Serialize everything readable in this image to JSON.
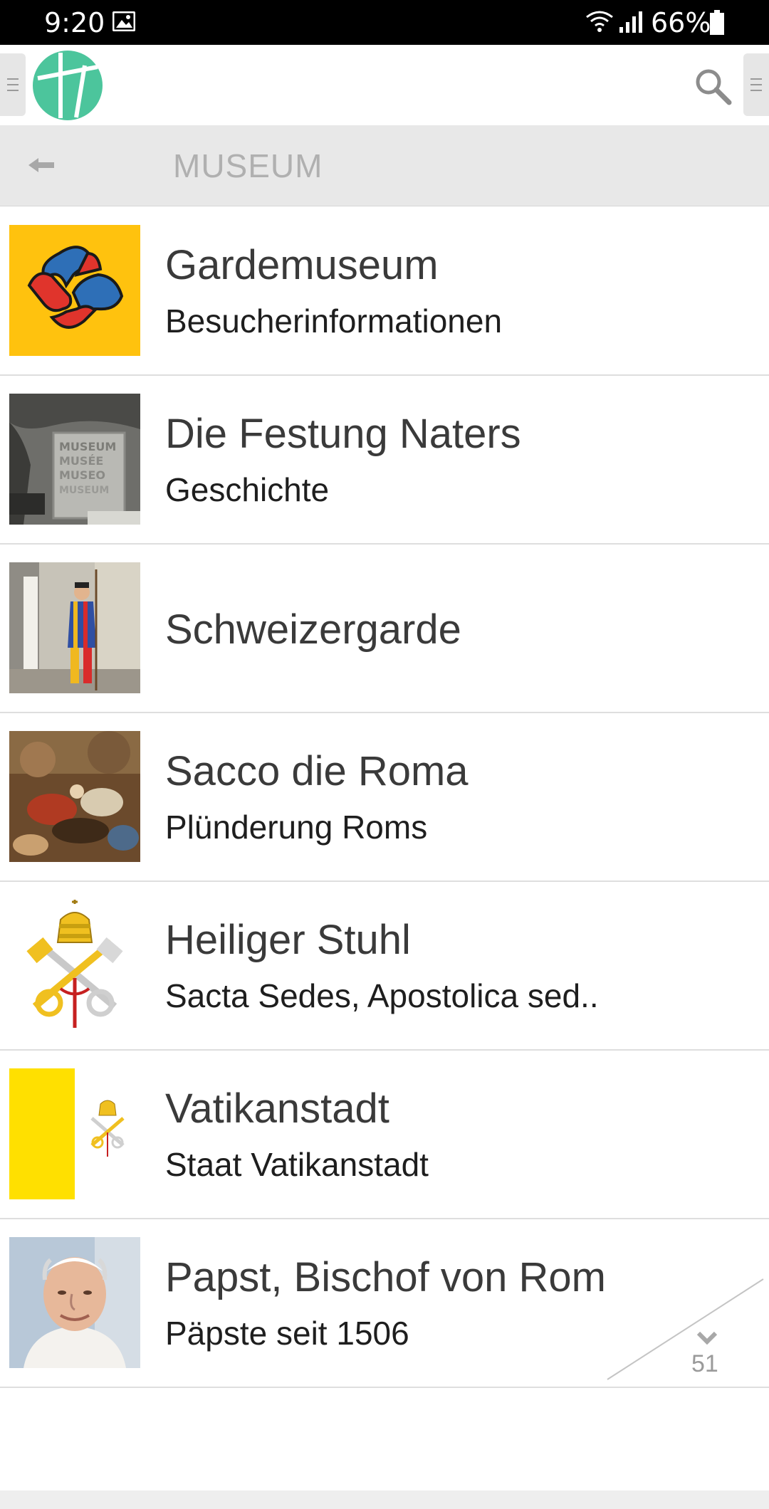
{
  "status_bar": {
    "time": "9:20",
    "battery": "66%"
  },
  "header": {
    "logo_icon": "app-logo",
    "search_icon": "search-icon",
    "menu_icon": "menu-icon"
  },
  "subheader": {
    "back_icon": "back-arrow-icon",
    "title": "MUSEUM"
  },
  "items": [
    {
      "title": "Gardemuseum",
      "subtitle": "Besucherinformationen"
    },
    {
      "title": "Die Festung Naters",
      "subtitle": "Geschichte"
    },
    {
      "title": "Schweizergarde",
      "subtitle": ""
    },
    {
      "title": "Sacco die Roma",
      "subtitle": "Plünderung Roms"
    },
    {
      "title": "Heiliger Stuhl",
      "subtitle": "Sacta Sedes, Apostolica sed.."
    },
    {
      "title": "Vatikanstadt",
      "subtitle": "Staat Vatikanstadt"
    },
    {
      "title": "Papst, Bischof von Rom",
      "subtitle": "Päpste seit 1506"
    }
  ],
  "thumb_text": {
    "museum_sign": "MUSEUM MUSÉE MUSEO MUSEUM"
  },
  "pager": {
    "count": "51",
    "icon": "chevron-down-icon"
  },
  "colors": {
    "accent": "#4cc59c",
    "subheader_bg": "#e8e8e8",
    "title_text": "#3a3a3a",
    "vatican_yellow": "#ffe000"
  }
}
